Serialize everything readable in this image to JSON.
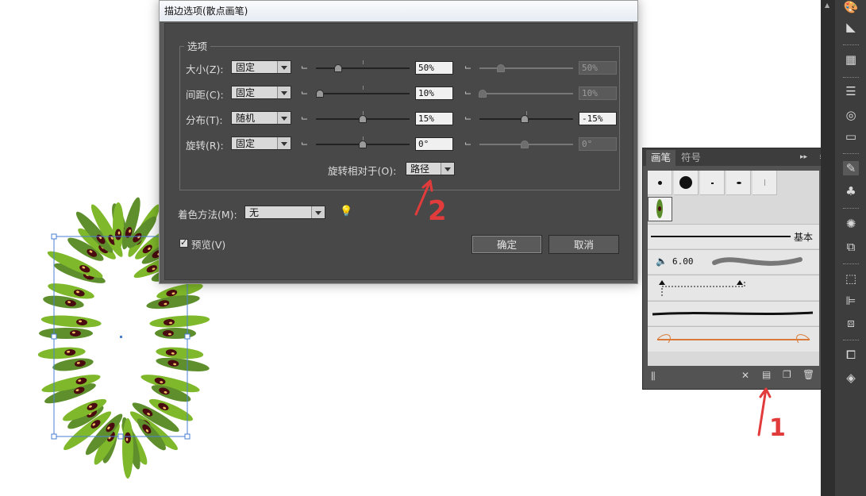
{
  "dialog": {
    "title": "描边选项(散点画笔)",
    "group_label": "选项",
    "rows": [
      {
        "label": "大小(Z):",
        "mode": "固定",
        "value1": "50%",
        "value2": "50%",
        "value2_disabled": true
      },
      {
        "label": "间距(C):",
        "mode": "固定",
        "value1": "10%",
        "value2": "10%",
        "value2_disabled": true
      },
      {
        "label": "分布(T):",
        "mode": "随机",
        "value1": "15%",
        "value2": "-15%",
        "value2_disabled": false
      },
      {
        "label": "旋转(R):",
        "mode": "固定",
        "value1": "0°",
        "value2": "0°",
        "value2_disabled": true
      }
    ],
    "rotation_relative_label": "旋转相对于(O):",
    "rotation_relative_value": "路径",
    "colorization_label": "着色方法(M):",
    "colorization_value": "无",
    "preview_label": "预览(V)",
    "preview_checked": true,
    "ok_label": "确定",
    "cancel_label": "取消"
  },
  "brushes_panel": {
    "tab_active": "画笔",
    "tab_inactive": "符号",
    "basic_label": "基本",
    "brush_size_value": "6.00"
  },
  "annotations": {
    "note1": "1",
    "note2": "2",
    "color": "#e23b3b"
  },
  "toolbar_icons": [
    "palette-icon",
    "gradient-icon",
    "swatch-grid-icon",
    "stroke-lines-icon",
    "transparency-icon",
    "gradient-bar-icon",
    "brush-icon",
    "symbol-club-icon",
    "graphic-style-icon",
    "export-icon",
    "artboard-icon",
    "align-icon",
    "arrange-icon",
    "pathfinder-icon",
    "layers-icon"
  ]
}
